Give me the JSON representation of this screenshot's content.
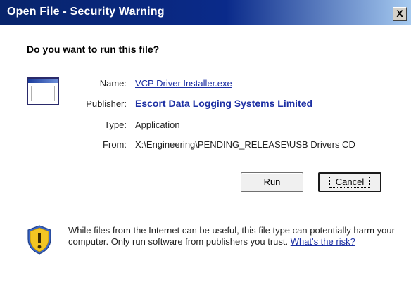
{
  "window": {
    "title": "Open File - Security Warning",
    "close_label": "X"
  },
  "question": "Do you want to run this file?",
  "icons": {
    "file": "application-window-icon",
    "shield": "security-shield-warning-icon"
  },
  "file_info": {
    "name_label": "Name:",
    "name_value": "VCP Driver Installer.exe",
    "publisher_label": "Publisher:",
    "publisher_value": "Escort Data Logging Systems Limited",
    "type_label": "Type:",
    "type_value": "Application",
    "from_label": "From:",
    "from_value": "X:\\Engineering\\PENDING_RELEASE\\USB Drivers CD"
  },
  "buttons": {
    "run": "Run",
    "cancel": "Cancel"
  },
  "warning": {
    "text": "While files from the Internet can be useful, this file type can potentially harm your computer. Only run software from publishers you trust. ",
    "link": "What's the risk?"
  },
  "colors": {
    "titlebar_start": "#08246b",
    "titlebar_end": "#a6caf0",
    "link": "#1c2fa3"
  }
}
